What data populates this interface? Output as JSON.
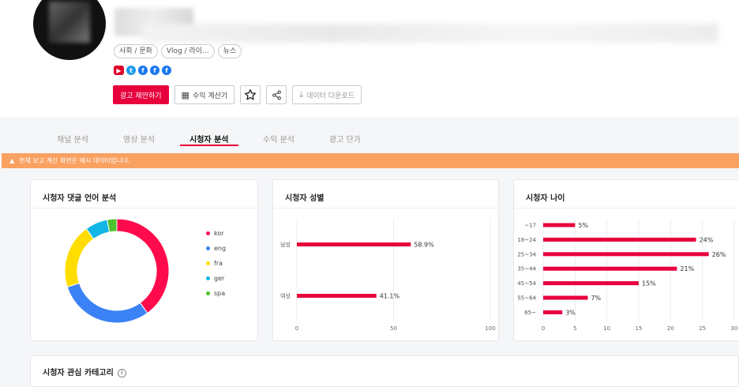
{
  "channel": {
    "tags": [
      "사회 / 문화",
      "Vlog / 라이...",
      "뉴스"
    ],
    "socials": [
      {
        "name": "youtube-icon",
        "glyph": "▶",
        "kind": "yt"
      },
      {
        "name": "twitter-icon",
        "glyph": "t",
        "kind": "tw"
      },
      {
        "name": "facebook-icon",
        "glyph": "f",
        "kind": "fb"
      },
      {
        "name": "facebook-icon",
        "glyph": "f",
        "kind": "fb"
      },
      {
        "name": "facebook-icon",
        "glyph": "f",
        "kind": "fb"
      }
    ]
  },
  "actions": {
    "propose_ad": "광고 제안하기",
    "calc_label": "수익 계산기",
    "download_label": "데이터 다운로드"
  },
  "tabs": [
    "채널 분석",
    "영상 분석",
    "시청자 분석",
    "수익 분석",
    "광고 단가"
  ],
  "notice": "현재 보고 계신 화면은 예시 데이터입니다.",
  "cards": {
    "language": {
      "title": "시청자 댓글 언어 분석"
    },
    "gender": {
      "title": "시청자 성별"
    },
    "age": {
      "title": "시청자 나이"
    },
    "category": {
      "title": "시청자 관심 카테고리"
    }
  },
  "colors": {
    "accent": "#e8003d",
    "notice": "#f9a161"
  },
  "chart_data": [
    {
      "type": "pie",
      "title": "시청자 댓글 언어 분석",
      "categories": [
        "kor",
        "eng",
        "fra",
        "ger",
        "spa"
      ],
      "values": [
        40,
        30,
        20,
        7,
        3
      ],
      "colors": [
        "#ff0a4c",
        "#3b82f6",
        "#ffdd00",
        "#13b6e6",
        "#4ec22f"
      ],
      "legend": "right"
    },
    {
      "type": "bar",
      "orientation": "horizontal",
      "title": "시청자 성별",
      "categories": [
        "남성",
        "여성"
      ],
      "values": [
        58.9,
        41.1
      ],
      "value_labels": [
        "58.9%",
        "41.1%"
      ],
      "xlim": [
        0,
        100
      ],
      "xticks": [
        "0",
        "50",
        "100"
      ],
      "color": "#e8003d",
      "grid": true
    },
    {
      "type": "bar",
      "orientation": "horizontal",
      "title": "시청자 나이",
      "categories": [
        "~17",
        "18~24",
        "25~34",
        "35~44",
        "45~54",
        "55~64",
        "65~"
      ],
      "values": [
        5,
        24,
        26,
        21,
        15,
        7,
        3
      ],
      "value_labels": [
        "5%",
        "24%",
        "26%",
        "21%",
        "15%",
        "7%",
        "3%"
      ],
      "xlim": [
        0,
        30
      ],
      "xticks": [
        "0",
        "5",
        "10",
        "15",
        "20",
        "25",
        "30"
      ],
      "color": "#e8003d",
      "grid": true
    }
  ]
}
